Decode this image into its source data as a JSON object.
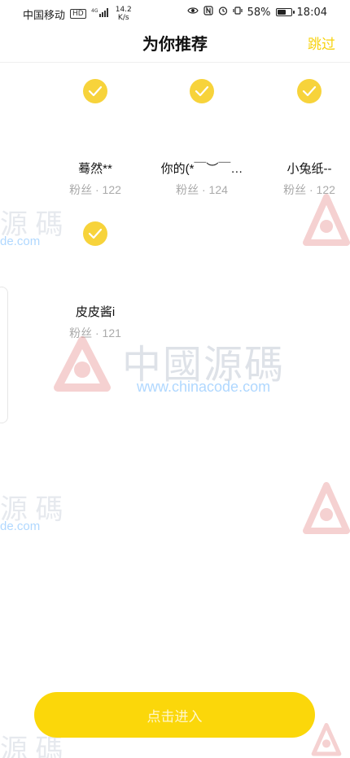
{
  "status_bar": {
    "carrier": "中国移动",
    "hd": "HD",
    "network_type": "4G",
    "speed": "14.2\nK/s",
    "battery_percent": "58%",
    "time": "18:04",
    "icons": [
      "eye-icon",
      "nfc-icon",
      "alarm-icon",
      "vibrate-icon",
      "battery-icon",
      "signal-icon"
    ]
  },
  "header": {
    "title": "为你推荐",
    "skip_label": "跳过"
  },
  "users": [
    {
      "name": "蓦然**",
      "fans": "粉丝 · 122",
      "selected": true
    },
    {
      "name": "你的(*￣︶￣…",
      "fans": "粉丝 · 124",
      "selected": true
    },
    {
      "name": "小兔纸--",
      "fans": "粉丝 · 122",
      "selected": true
    },
    {
      "name": "皮皮酱i",
      "fans": "粉丝 · 121",
      "selected": true
    }
  ],
  "bottom": {
    "enter_label": "点击进入"
  },
  "watermark": {
    "main_text": "中國源碼",
    "url_text": "www.chinacode.com",
    "partial_text": "源 碼",
    "partial_url": "de.com"
  },
  "colors": {
    "accent": "#f7d33b",
    "button": "#fbd70a",
    "skip": "#f7d20e",
    "fans_text": "#aaaaaa"
  }
}
